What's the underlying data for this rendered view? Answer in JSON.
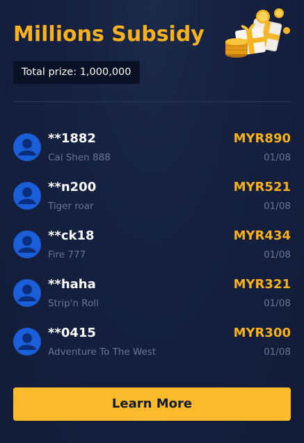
{
  "header": {
    "title": "Millions Subsidy",
    "total_prize": "Total prize: 1,000,000",
    "gift_icon": "gift-coins-icon"
  },
  "winners": [
    {
      "name": "**1882",
      "game": "Cai Shen 888",
      "amount": "MYR890",
      "date": "01/08"
    },
    {
      "name": "**n200",
      "game": "Tiger roar",
      "amount": "MYR521",
      "date": "01/08"
    },
    {
      "name": "**ck18",
      "game": "Fire 777",
      "amount": "MYR434",
      "date": "01/08"
    },
    {
      "name": "**haha",
      "game": "Strip'n Roll",
      "amount": "MYR321",
      "date": "01/08"
    },
    {
      "name": "**0415",
      "game": "Adventure To The West",
      "amount": "MYR300",
      "date": "01/08"
    }
  ],
  "button": {
    "label": "Learn More"
  },
  "colors": {
    "accent": "#f9b21e",
    "background": "#152040",
    "avatar": "#1a5fd9"
  }
}
